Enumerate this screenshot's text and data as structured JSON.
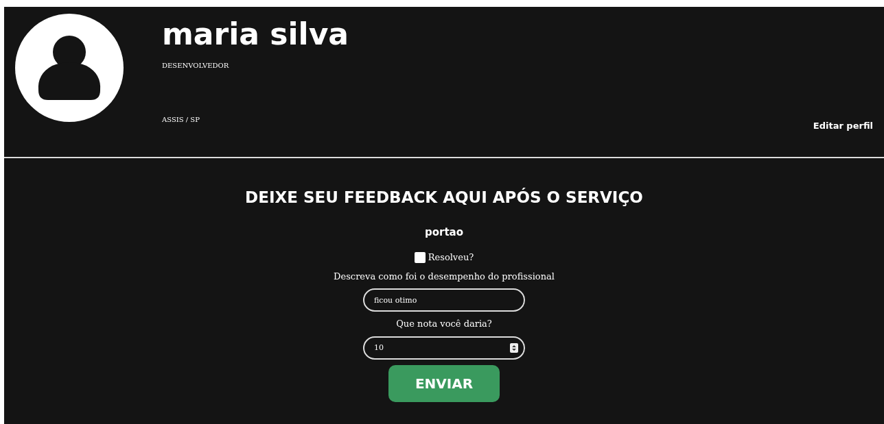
{
  "profile": {
    "name": "maria silva",
    "role": "DESENVOLVEDOR",
    "location": "ASSIS / SP",
    "edit_link": "Editar perfil"
  },
  "feedback": {
    "heading": "DEIXE SEU FEEDBACK AQUI APÓS O SERVIÇO",
    "service": "portao",
    "resolved": {
      "label": "Resolveu?",
      "checked": false
    },
    "description_label": "Descreva como foi o desempenho do profissional",
    "description_value": "ficou otimo",
    "rating_label": "Que nota você daria?",
    "rating_value": "10",
    "submit": "ENVIAR"
  }
}
